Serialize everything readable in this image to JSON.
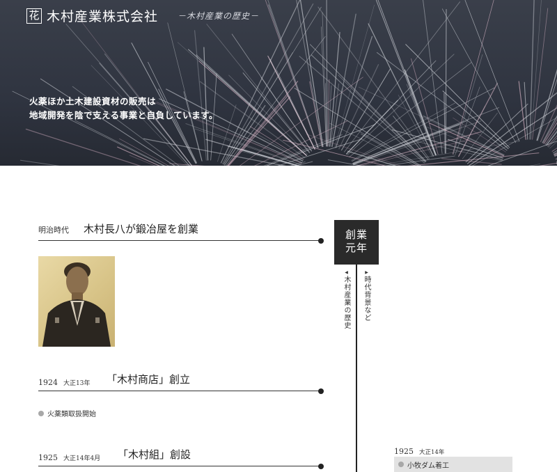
{
  "header": {
    "logo_char": "花",
    "company": "木村産業株式会社",
    "history_label": "－木村産業の歴史－",
    "tagline_line1": "火薬ほか土木建設資材の販売は",
    "tagline_line2": "地域開発を陰で支える事業と自負しています。"
  },
  "timeline": {
    "center_box_line1": "創業",
    "center_box_line2": "元年",
    "left_vertical_label": "木村産業の歴史",
    "right_vertical_label": "時代背景など",
    "left_marker": "◀",
    "right_marker": "▶",
    "entries": [
      {
        "era": "明治時代",
        "title": "木村長八が鍛冶屋を創業"
      },
      {
        "year": "1924",
        "era": "大正13年",
        "title": "「木村商店」創立",
        "bullet": "火薬類取扱開始"
      },
      {
        "year": "1925",
        "era": "大正14年4月",
        "title": "「木村組」創設"
      }
    ],
    "right_entries": [
      {
        "year": "1925",
        "era": "大正14年",
        "bullet": "小牧ダム着工"
      }
    ]
  },
  "colors": {
    "hero_bg": "#2f3440",
    "center_box": "#2a2a2a",
    "bullet": "#a8a8a8",
    "right_box_bg": "#e2e2e2"
  }
}
